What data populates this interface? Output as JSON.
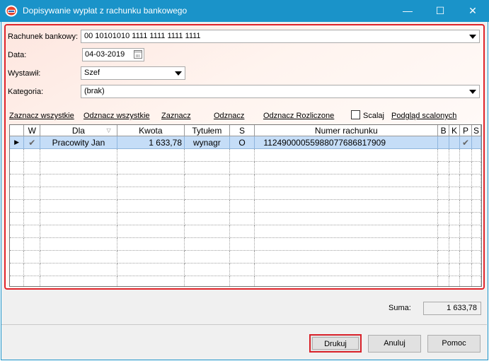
{
  "window": {
    "title": "Dopisywanie wypłat z rachunku bankowego",
    "minimize_glyph": "—",
    "maximize_glyph": "☐",
    "close_glyph": "✕",
    "accent_color": "#1a93c9"
  },
  "form": {
    "rachunek_label": "Rachunek bankowy:",
    "rachunek_value": "00 10101010 1111 1111 1111 1111",
    "data_label": "Data:",
    "data_value": "04-03-2019",
    "wystawil_label": "Wystawił:",
    "wystawil_value": "Szef",
    "kategoria_label": "Kategoria:",
    "kategoria_value": "(brak)"
  },
  "links": {
    "zaznacz_wszystkie": "Zaznacz wszystkie",
    "odznacz_wszystkie": "Odznacz wszystkie",
    "zaznacz": "Zaznacz",
    "odznacz": "Odznacz",
    "odznacz_rozliczone": "Odznacz Rozliczone",
    "scalaj": "Scalaj",
    "podglad_scalonych": "Podgląd scalonych"
  },
  "table": {
    "columns": [
      "W",
      "Dla",
      "Kwota",
      "Tytułem",
      "S",
      "Numer rachunku",
      "B",
      "K",
      "P",
      "S"
    ],
    "rows": [
      {
        "indicator": "▶",
        "w": "✔",
        "dla": "Pracowity Jan",
        "kwota": "1 633,78",
        "tytulem": "wynagr",
        "s": "O",
        "numer": "11249000055988077686817909",
        "b": "",
        "k": "",
        "p": "✔",
        "s2": ""
      }
    ]
  },
  "footer": {
    "suma_label": "Suma:",
    "suma_value": "1 633,78",
    "drukuj": "Drukuj",
    "anuluj": "Anuluj",
    "pomoc": "Pomoc"
  },
  "icons": {
    "app": "app-logo-icon",
    "calendar": "calendar-icon",
    "sort": "sort-indicator-icon"
  }
}
